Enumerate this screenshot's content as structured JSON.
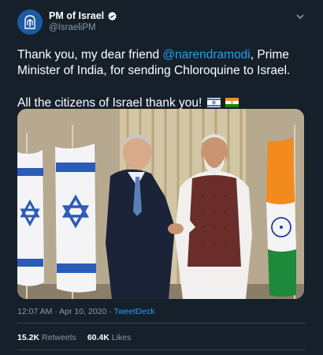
{
  "tweet": {
    "display_name": "PM of Israel",
    "handle": "@IsraeliPM",
    "text_part1": "Thank you, my dear friend ",
    "mention": "@narendramodi",
    "text_part2": ", Prime Minister of India, for sending Chloroquine to Israel.",
    "text_line2": "All the citizens of Israel thank you!",
    "flags": [
      "israel-flag",
      "india-flag"
    ],
    "timestamp": "12:07 AM · Apr 10, 2020 · ",
    "client": "TweetDeck",
    "retweets_count": "15.2K",
    "retweets_label": "Retweets",
    "likes_count": "60.4K",
    "likes_label": "Likes"
  },
  "colors": {
    "background": "#15202b",
    "link": "#1da1f2",
    "muted": "#8899a6",
    "divider": "#38444d"
  },
  "icons": {
    "avatar": "israel-emblem-icon",
    "verified": "verified-badge-icon",
    "caret": "chevron-down-icon"
  }
}
